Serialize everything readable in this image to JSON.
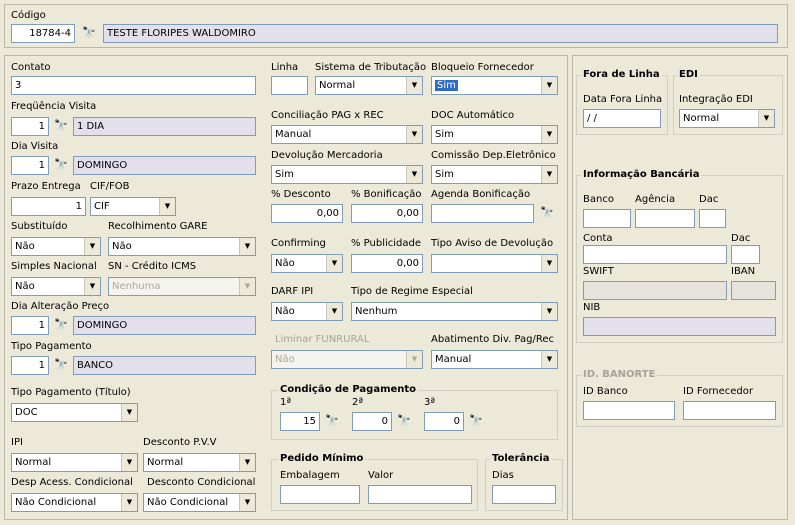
{
  "codigo": {
    "label": "Código",
    "value": "18784-4",
    "nome": "TESTE FLORIPES WALDOMIRO"
  },
  "contato": {
    "label": "Contato",
    "value": "3"
  },
  "freq": {
    "label": "Freqüência Visita",
    "num": "1",
    "desc": "1 DIA"
  },
  "dia_visita": {
    "label": "Dia Visita",
    "num": "1",
    "desc": "DOMINGO"
  },
  "prazo": {
    "label": "Prazo Entrega",
    "value": "1"
  },
  "ciffob": {
    "label": "CIF/FOB",
    "value": "CIF"
  },
  "substituido": {
    "label": "Substituído",
    "value": "Não"
  },
  "gare": {
    "label": "Recolhimento GARE",
    "value": "Não"
  },
  "simples": {
    "label": "Simples Nacional",
    "value": "Não"
  },
  "sn_icms": {
    "label": "SN - Crédito ICMS",
    "value": "Nenhuma"
  },
  "dia_alt": {
    "label": "Dia Alteração Preço",
    "num": "1",
    "desc": "DOMINGO"
  },
  "tipo_pag": {
    "label": "Tipo Pagamento",
    "num": "1",
    "desc": "BANCO"
  },
  "tipo_tit": {
    "label": "Tipo Pagamento (Título)",
    "value": "DOC"
  },
  "ipi": {
    "label": "IPI",
    "value": "Normal"
  },
  "desc_pvv": {
    "label": "Desconto P.V.V",
    "value": "Normal"
  },
  "desp_acess": {
    "label": "Desp Acess. Condicional",
    "value": "Não Condicional"
  },
  "desc_cond": {
    "label": "Desconto Condicional",
    "value": "Não Condicional"
  },
  "linha": {
    "label": "Linha",
    "value": ""
  },
  "sist_trib": {
    "label": "Sistema de Tributação",
    "value": "Normal"
  },
  "bloqueio": {
    "label": "Bloqueio Fornecedor",
    "value": "Sim"
  },
  "conciliacao": {
    "label": "Conciliação PAG x REC",
    "value": "Manual"
  },
  "doc_auto": {
    "label": "DOC Automático",
    "value": "Sim"
  },
  "devolucao": {
    "label": "Devolução Mercadoria",
    "value": "Sim"
  },
  "comissao": {
    "label": "Comissão Dep.Eletrônico",
    "value": "Sim"
  },
  "pct_desc": {
    "label": "% Desconto",
    "value": "0,00"
  },
  "pct_bon": {
    "label": "% Bonificação",
    "value": "0,00"
  },
  "agenda": {
    "label": "Agenda Bonificação",
    "value": ""
  },
  "confirming": {
    "label": "Confirming",
    "value": "Não"
  },
  "pct_pub": {
    "label": "% Publicidade",
    "value": "0,00"
  },
  "tipo_aviso": {
    "label": "Tipo Aviso de Devolução",
    "value": ""
  },
  "darf": {
    "label": "DARF IPI",
    "value": "Não"
  },
  "regime": {
    "label": "Tipo de Regime Especial",
    "value": "Nenhum"
  },
  "funrural": {
    "label": "Liminar FUNRURAL",
    "value": "Não"
  },
  "abatimento": {
    "label": "Abatimento Div. Pag/Rec",
    "value": "Manual"
  },
  "cond_pag": {
    "title": "Condição de Pagamento",
    "l1": "1ª",
    "l2": "2ª",
    "l3": "3ª",
    "v1": "15",
    "v2": "0",
    "v3": "0"
  },
  "pedido": {
    "title": "Pedido Mínimo",
    "emb_label": "Embalagem",
    "valor_label": "Valor"
  },
  "tolerancia": {
    "title": "Tolerância",
    "dias_label": "Dias"
  },
  "fora_linha": {
    "title": "Fora de Linha",
    "data_label": "Data Fora Linha",
    "data_value": " / /"
  },
  "edi": {
    "title": "EDI",
    "integ_label": "Integração EDI",
    "integ_value": "Normal"
  },
  "banco": {
    "title": "Informação Bancária",
    "banco": "Banco",
    "agencia": "Agência",
    "dac": "Dac",
    "conta": "Conta",
    "dac2": "Dac",
    "swift": "SWIFT",
    "iban": "IBAN",
    "nib": "NIB"
  },
  "banorte": {
    "title": "ID. BANORTE",
    "id_banco": "ID Banco",
    "id_forn": "ID Fornecedor"
  },
  "icons": {
    "search": "binoculars-icon",
    "dropdown": "chevron-down-icon"
  }
}
